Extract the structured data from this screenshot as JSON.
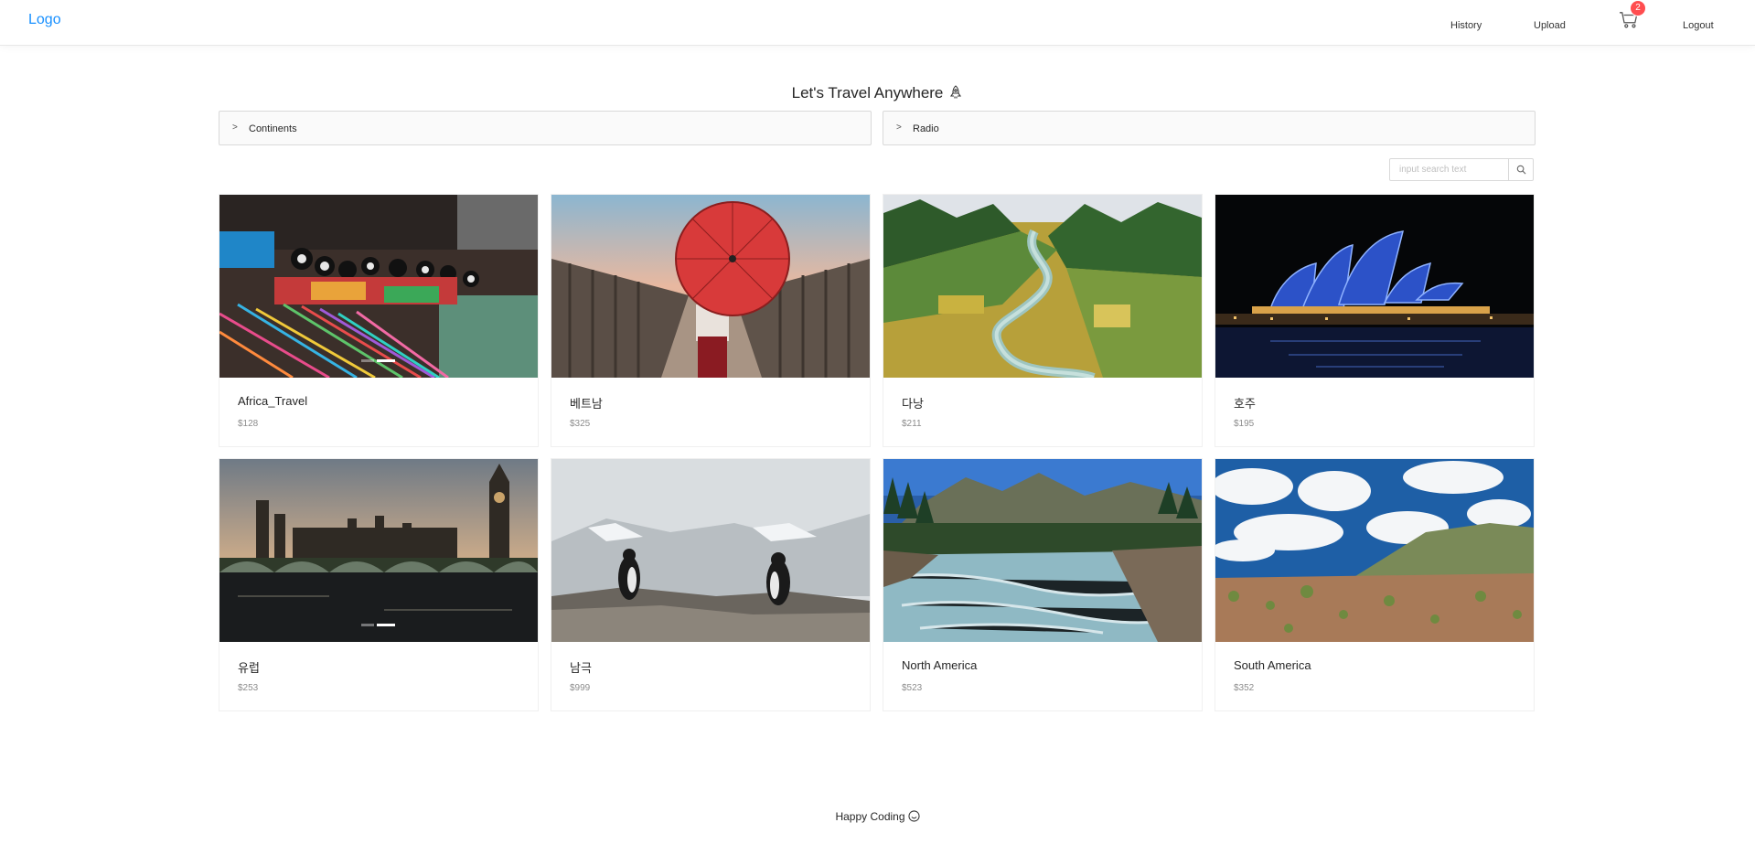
{
  "header": {
    "logo": "Logo",
    "nav": {
      "history": "History",
      "upload": "Upload",
      "logout": "Logout"
    },
    "cart_count": "2",
    "accent_color": "#1890ff",
    "cart_icon": "shopping-cart-icon"
  },
  "main": {
    "title": "Let's Travel Anywhere",
    "title_icon": "rocket-icon",
    "filters": [
      {
        "label": "Continents"
      },
      {
        "label": "Radio"
      }
    ],
    "search": {
      "placeholder": "input search text",
      "value": ""
    },
    "products": [
      {
        "name": "Africa_Travel",
        "price": "$128"
      },
      {
        "name": "베트남",
        "price": "$325"
      },
      {
        "name": "다낭",
        "price": "$211"
      },
      {
        "name": "호주",
        "price": "$195"
      },
      {
        "name": "유럽",
        "price": "$253"
      },
      {
        "name": "남극",
        "price": "$999"
      },
      {
        "name": "North America",
        "price": "$523"
      },
      {
        "name": "South America",
        "price": "$352"
      }
    ]
  },
  "footer": {
    "text": "Happy Coding",
    "icon": "smile-icon"
  }
}
